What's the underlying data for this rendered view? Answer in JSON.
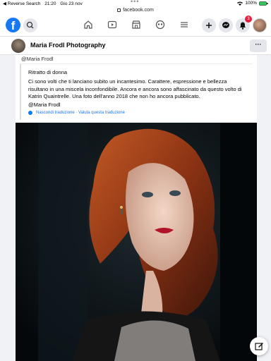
{
  "statusbar": {
    "back_app": "◀ Reverse Search",
    "time": "21:20",
    "date": "Gio 23 nov",
    "battery": "100%"
  },
  "browser": {
    "url": "facebook.com"
  },
  "fbnav": {
    "logo": "f",
    "notification_count": "3"
  },
  "page": {
    "name": "Maria Frodl Photography",
    "more_label": "···"
  },
  "post": {
    "author_mention": "@Maria Frodl",
    "title": "Ritratto di donna",
    "body": "Ci sono volti che ti lanciano subito un incantesimo. Carattere, espressione e bellezza risultano in una miscela inconfondibile. Ancora e ancora sono affascinato da questo volto di Katrin Quaintrelle. Una foto dell'anno 2018 che non ho ancora pubblicato.",
    "signature": "@Maria Frodl",
    "translation_links": "Nascondi traduzione · Valuta questa traduzione"
  },
  "colors": {
    "brand": "#1877f2",
    "badge": "#e41e3f"
  }
}
